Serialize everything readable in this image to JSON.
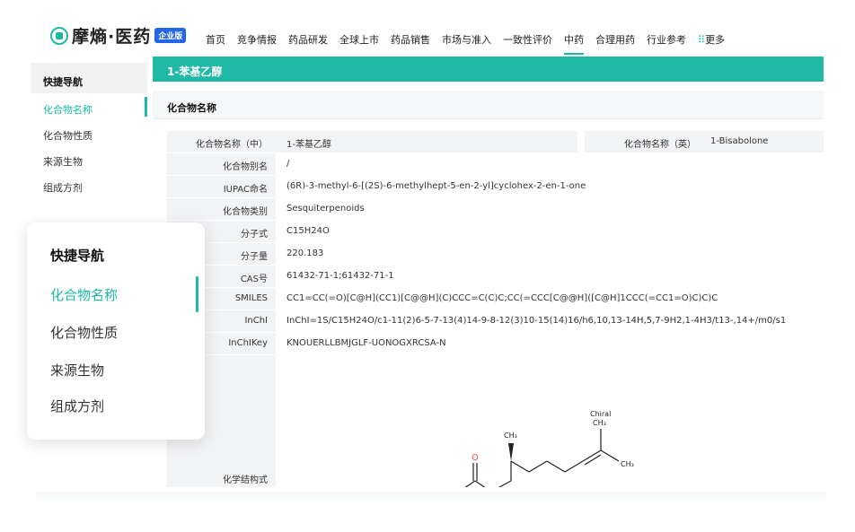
{
  "brand": {
    "name": "摩熵·医药",
    "badge": "企业版"
  },
  "nav": {
    "items": [
      "首页",
      "竞争情报",
      "药品研发",
      "全球上市",
      "药品销售",
      "市场与准入",
      "一致性评价",
      "中药",
      "合理用药",
      "行业参考"
    ],
    "active": "中药",
    "more_label": "更多",
    "more_icon": "grid-icon"
  },
  "sidebar": {
    "title": "快捷导航",
    "items": [
      "化合物名称",
      "化合物性质",
      "来源生物",
      "组成方剂"
    ],
    "active": "化合物名称"
  },
  "main": {
    "header": "1-苯基乙醇",
    "section": "化合物名称",
    "name_cn_label": "化合物名称（中）",
    "name_cn": "1-苯基乙醇",
    "name_en_label": "化合物名称（英）",
    "name_en": "1-Bisabolone",
    "alias_label": "化合物别名",
    "alias": "/",
    "iupac_label": "IUPAC命名",
    "iupac": "(6R)-3-methyl-6-[(2S)-6-methylhept-5-en-2-yl]cyclohex-2-en-1-one",
    "class_label": "化合物类别",
    "class": "Sesquiterpenoids",
    "formula_label": "分子式",
    "formula": "C15H24O",
    "mw_label": "分子量",
    "mw": "220.183",
    "cas_label": "CAS号",
    "cas": "61432-71-1;61432-71-1",
    "smiles_label": "SMILES",
    "smiles": "CC1=CC(=O)[C@H](CC1)[C@@H](C)CCC=C(C)C;CC(=CCC[C@@H]([C@H]1CCC(=CC1=O)C)C)C",
    "inchi_label": "InChI",
    "inchi": "InChI=1S/C15H24O/c1-11(2)6-5-7-13(4)14-9-8-12(3)10-15(14)16/h6,10,13-14H,5,7-9H2,1-4H3/t13-,14+/m0/s1",
    "inchikey_label": "InChIKey",
    "inchikey": "KNOUERLLBMJGLF-UONOGXRCSA-N",
    "structure_label": "化学结构式",
    "structure_text": {
      "o": "O",
      "ch3_a": "CH₃",
      "chiral": "Chiral",
      "ch3_b": "CH₃",
      "ch3_c": "CH₃"
    }
  },
  "card": {
    "title": "快捷导航",
    "items": [
      "化合物名称",
      "化合物性质",
      "来源生物",
      "组成方剂"
    ],
    "active": "化合物名称"
  },
  "colors": {
    "accent": "#1cb9a5",
    "badge": "#2566e8"
  }
}
